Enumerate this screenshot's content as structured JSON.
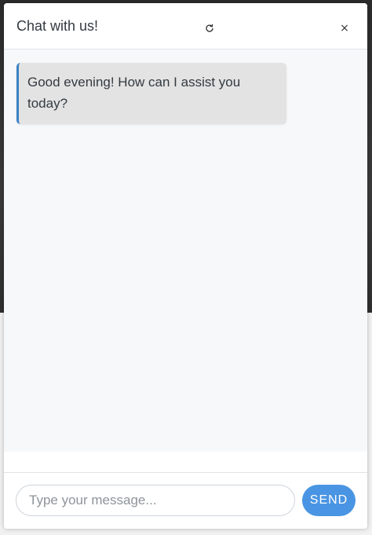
{
  "chat": {
    "title": "Chat with us!",
    "refresh_icon": "refresh-icon",
    "close_icon": "close-icon",
    "close_glyph": "×",
    "messages": [
      {
        "sender": "bot",
        "text": "Good evening! How can I assist you today?"
      }
    ],
    "input": {
      "placeholder": "Type your message...",
      "value": ""
    },
    "send_label": "SEND"
  },
  "colors": {
    "accent": "#4a95e3",
    "bubble_border": "#3b82c4",
    "bubble_bg": "#e3e3e3",
    "messages_bg": "#f6f8fa"
  }
}
